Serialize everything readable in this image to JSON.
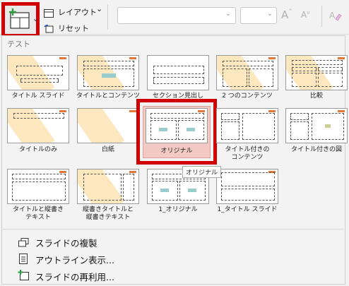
{
  "toolbar": {
    "new_slide_icon": "new-slide-layout-icon",
    "layout_label": "レイアウト",
    "layout_chevron": "⌄",
    "reset_label": "リセット",
    "font_grow": "A",
    "font_shrink": "A",
    "accent_color": "#d00000"
  },
  "panel": {
    "section_title": "テスト",
    "layouts": [
      {
        "label": "タイトル スライド"
      },
      {
        "label": "タイトルとコンテンツ"
      },
      {
        "label": "セクション見出し"
      },
      {
        "label": "2 つのコンテンツ"
      },
      {
        "label": "比較"
      },
      {
        "label": "タイトルのみ"
      },
      {
        "label": "白紙"
      },
      {
        "label": "オリジナル"
      },
      {
        "label": "タイトル付きの\nコンテンツ"
      },
      {
        "label": "タイトル付きの図"
      },
      {
        "label": "タイトルと縦書き\nテキスト"
      },
      {
        "label": "縦書きタイトルと\n縦書きテキスト"
      },
      {
        "label": "1_オリジナル"
      },
      {
        "label": "1_タイトル スライド"
      }
    ],
    "tooltip": "オリジナル"
  },
  "menu": {
    "duplicate": "スライドの複製",
    "outline": "アウトライン表示...",
    "reuse": "スライドの再利用..."
  }
}
